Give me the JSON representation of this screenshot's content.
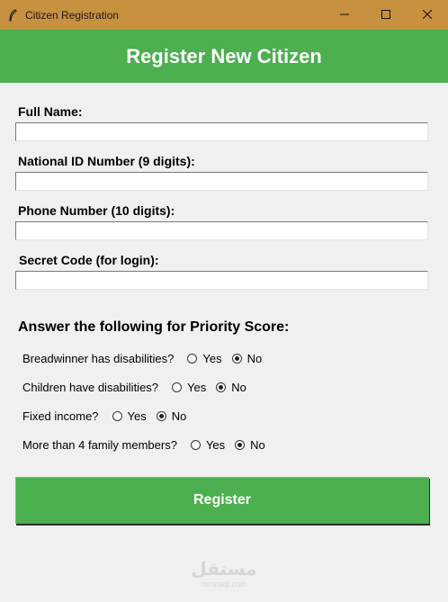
{
  "window": {
    "title": "Citizen Registration",
    "icon": "feather-icon",
    "controls": [
      "minimize-icon",
      "maximize-icon",
      "close-icon"
    ]
  },
  "header": {
    "title": "Register New Citizen"
  },
  "form": {
    "fields": [
      {
        "label": "Full Name:",
        "value": ""
      },
      {
        "label": "National ID Number (9 digits):",
        "value": ""
      },
      {
        "label": "Phone Number (10 digits):",
        "value": ""
      },
      {
        "label": "Secret Code (for login):",
        "value": ""
      }
    ]
  },
  "priority": {
    "heading": "Answer the following for Priority Score:",
    "yes_label": "Yes",
    "no_label": "No",
    "questions": [
      {
        "text": "Breadwinner has disabilities?",
        "selected": "No"
      },
      {
        "text": "Children have disabilities?",
        "selected": "No"
      },
      {
        "text": "Fixed income?",
        "selected": "No"
      },
      {
        "text": "More than 4 family members?",
        "selected": "No"
      }
    ]
  },
  "actions": {
    "register_label": "Register"
  },
  "watermark": {
    "main": "مستقل",
    "sub": "mostaql.com"
  },
  "colors": {
    "titlebar": "#c8913f",
    "accent_green": "#4caf50",
    "background": "#f0f0f0"
  }
}
